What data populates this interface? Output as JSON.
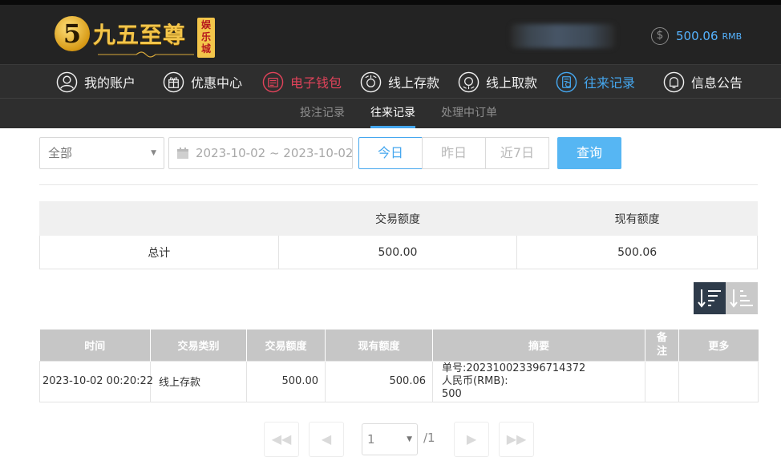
{
  "header": {
    "logo_char": "5",
    "logo_text": "九五至尊",
    "logo_sub": "娱乐城",
    "balance": "500.06",
    "currency": "RMB"
  },
  "nav": {
    "items": [
      {
        "label": "我的账户",
        "icon": "user-icon"
      },
      {
        "label": "优惠中心",
        "icon": "gift-icon"
      },
      {
        "label": "电子钱包",
        "icon": "wallet-icon"
      },
      {
        "label": "线上存款",
        "icon": "deposit-icon"
      },
      {
        "label": "线上取款",
        "icon": "withdraw-icon"
      },
      {
        "label": "往来记录",
        "icon": "records-icon"
      },
      {
        "label": "信息公告",
        "icon": "bell-icon"
      }
    ],
    "active_color": "#45a7ef",
    "highlight_color": "#e0435a"
  },
  "subnav": {
    "items": [
      "投注记录",
      "往来记录",
      "处理中订单"
    ],
    "active": "往来记录"
  },
  "filters": {
    "type_value": "全部",
    "date_range": "2023-10-02 ~ 2023-10-02",
    "quick": [
      "今日",
      "昨日",
      "近7日"
    ],
    "query_label": "查询"
  },
  "summary": {
    "headers": [
      "",
      "交易额度",
      "现有额度"
    ],
    "row_label": "总计",
    "trade_total": "500.00",
    "current_total": "500.06"
  },
  "records": {
    "headers": [
      "时间",
      "交易类别",
      "交易额度",
      "现有额度",
      "摘要",
      "备注",
      "更多"
    ],
    "rows": [
      {
        "time": "2023-10-02 00:20:22",
        "type": "线上存款",
        "amount": "500.00",
        "balance": "500.06",
        "summary_line1": "单号:202310023396714372",
        "summary_line2": "人民币(RMB):",
        "summary_line3": "500",
        "note": "",
        "more": ""
      }
    ]
  },
  "pagination": {
    "current_page": "1",
    "total": "/1"
  }
}
